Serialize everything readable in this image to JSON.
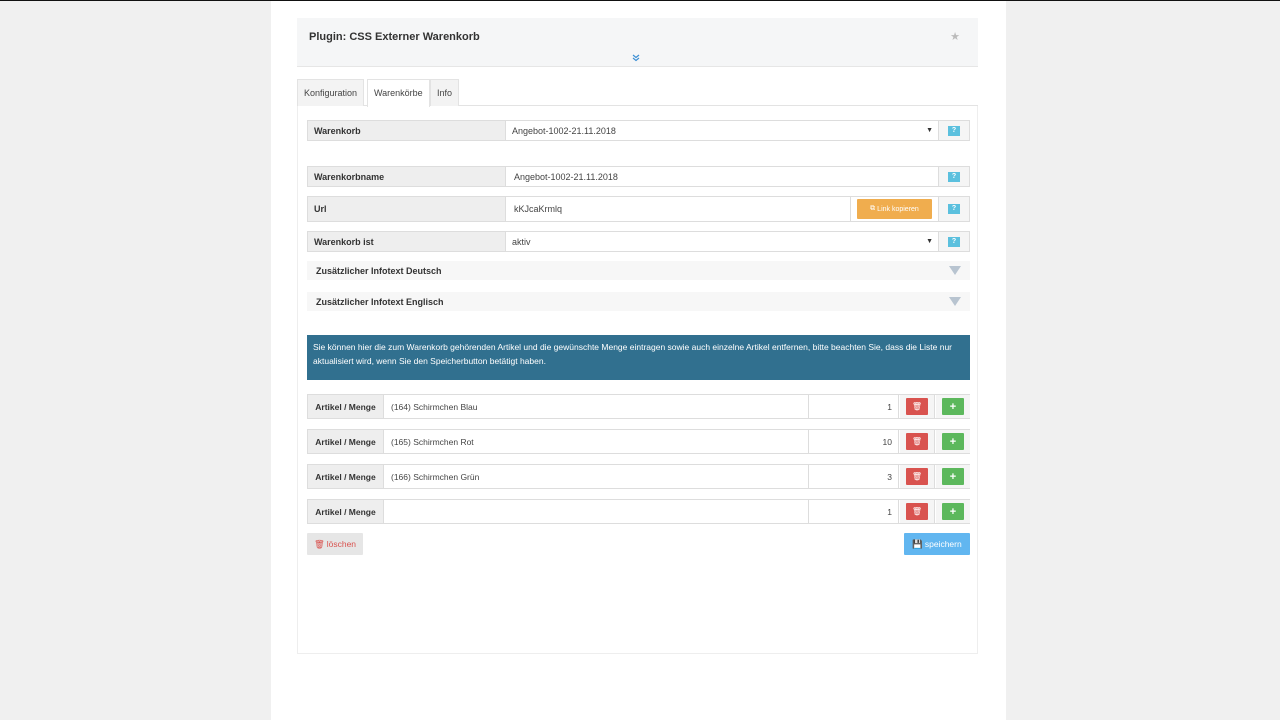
{
  "plugin": {
    "title": "Plugin: CSS Externer Warenkorb",
    "favorite_icon": "star-icon",
    "expand_icon": "double-chevron-down-icon"
  },
  "tabs": [
    {
      "label": "Konfiguration",
      "active": false
    },
    {
      "label": "Warenkörbe",
      "active": true
    },
    {
      "label": "Info",
      "active": false
    }
  ],
  "form": {
    "warenkorb": {
      "label": "Warenkorb",
      "value": "Angebot-1002-21.11.2018"
    },
    "warenkorbname": {
      "label": "Warenkorbname",
      "value": "Angebot-1002-21.11.2018"
    },
    "url": {
      "label": "Url",
      "value": "kKJcaKrmlq",
      "copy_button": "Link kopieren"
    },
    "status": {
      "label": "Warenkorb ist",
      "value": "aktiv"
    },
    "help_label": "?"
  },
  "collapsibles": [
    {
      "label": "Zusätzlicher Infotext Deutsch"
    },
    {
      "label": "Zusätzlicher Infotext Englisch"
    }
  ],
  "info_text": "Sie können hier die zum Warenkorb gehörenden Artikel und die gewünschte Menge eintragen sowie auch einzelne Artikel entfernen, bitte beachten Sie, dass die Liste nur aktualisiert wird, wenn Sie den Speicherbutton betätigt haben.",
  "articles": {
    "label": "Artikel / Menge",
    "rows": [
      {
        "name": "(164) Schirmchen Blau",
        "qty": "1"
      },
      {
        "name": "(165) Schirmchen Rot",
        "qty": "10"
      },
      {
        "name": "(166) Schirmchen Grün",
        "qty": "3"
      },
      {
        "name": "",
        "qty": "1"
      }
    ],
    "delete_icon": "trash-icon",
    "add_icon": "plus-icon"
  },
  "actions": {
    "delete_label": "löschen",
    "save_label": "speichern"
  },
  "colors": {
    "info_bg": "#31708f",
    "danger": "#d9534f",
    "success": "#5cb85c",
    "warning": "#f0ad4e",
    "help": "#5bc0de",
    "save": "#61b6f0"
  }
}
